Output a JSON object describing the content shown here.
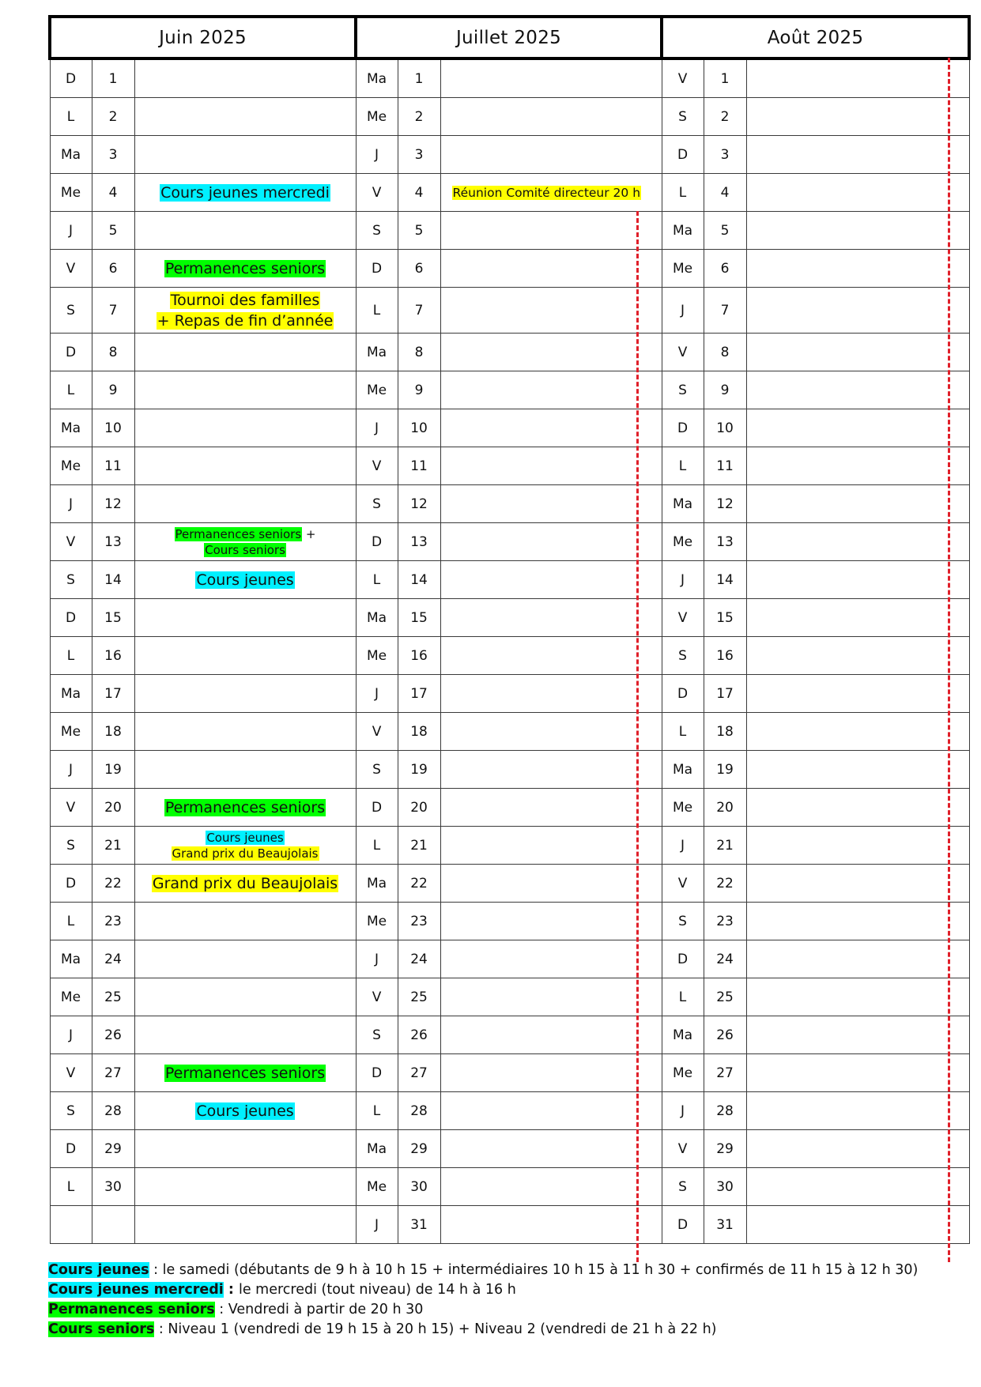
{
  "months": [
    {
      "label": "Juin 2025"
    },
    {
      "label": "Juillet 2025"
    },
    {
      "label": "Août 2025"
    }
  ],
  "highlight_colors": {
    "cyan": "#00f0ff",
    "green": "#00ff00",
    "yellow": "#ffff00",
    "dash_red": "#e0202a"
  },
  "rows": [
    {
      "juin": {
        "d": "D",
        "n": "1"
      },
      "juillet": {
        "d": "Ma",
        "n": "1"
      },
      "aout": {
        "d": "V",
        "n": "1"
      }
    },
    {
      "juin": {
        "d": "L",
        "n": "2"
      },
      "juillet": {
        "d": "Me",
        "n": "2"
      },
      "aout": {
        "d": "S",
        "n": "2"
      }
    },
    {
      "juin": {
        "d": "Ma",
        "n": "3"
      },
      "juillet": {
        "d": "J",
        "n": "3"
      },
      "aout": {
        "d": "D",
        "n": "3"
      }
    },
    {
      "juin": {
        "d": "Me",
        "n": "4",
        "events": [
          {
            "text": "Cours jeunes mercredi",
            "color": "cyan"
          }
        ]
      },
      "juillet": {
        "d": "V",
        "n": "4",
        "events": [
          {
            "text": "Réunion Comité directeur 20 h",
            "color": "yellow"
          }
        ]
      },
      "aout": {
        "d": "L",
        "n": "4"
      }
    },
    {
      "juin": {
        "d": "J",
        "n": "5"
      },
      "juillet": {
        "d": "S",
        "n": "5"
      },
      "aout": {
        "d": "Ma",
        "n": "5"
      }
    },
    {
      "juin": {
        "d": "V",
        "n": "6",
        "events": [
          {
            "text": "Permanences seniors",
            "color": "green"
          }
        ]
      },
      "juillet": {
        "d": "D",
        "n": "6"
      },
      "aout": {
        "d": "Me",
        "n": "6"
      }
    },
    {
      "juin": {
        "d": "S",
        "n": "7",
        "events": [
          {
            "text": "Tournoi des familles",
            "color": "yellow"
          },
          {
            "text": "+ Repas de fin d’année",
            "color": "yellow"
          }
        ]
      },
      "juillet": {
        "d": "L",
        "n": "7"
      },
      "aout": {
        "d": "J",
        "n": "7"
      }
    },
    {
      "juin": {
        "d": "D",
        "n": "8"
      },
      "juillet": {
        "d": "Ma",
        "n": "8"
      },
      "aout": {
        "d": "V",
        "n": "8"
      }
    },
    {
      "juin": {
        "d": "L",
        "n": "9"
      },
      "juillet": {
        "d": "Me",
        "n": "9"
      },
      "aout": {
        "d": "S",
        "n": "9"
      }
    },
    {
      "juin": {
        "d": "Ma",
        "n": "10"
      },
      "juillet": {
        "d": "J",
        "n": "10"
      },
      "aout": {
        "d": "D",
        "n": "10"
      }
    },
    {
      "juin": {
        "d": "Me",
        "n": "11"
      },
      "juillet": {
        "d": "V",
        "n": "11"
      },
      "aout": {
        "d": "L",
        "n": "11"
      }
    },
    {
      "juin": {
        "d": "J",
        "n": "12"
      },
      "juillet": {
        "d": "S",
        "n": "12"
      },
      "aout": {
        "d": "Ma",
        "n": "12"
      }
    },
    {
      "juin": {
        "d": "V",
        "n": "13",
        "small": true,
        "events": [
          {
            "text": "Permanences seniors",
            "color": "green",
            "suffix": " +"
          },
          {
            "text": "Cours seniors",
            "color": "green"
          }
        ]
      },
      "juillet": {
        "d": "D",
        "n": "13"
      },
      "aout": {
        "d": "Me",
        "n": "13"
      }
    },
    {
      "juin": {
        "d": "S",
        "n": "14",
        "events": [
          {
            "text": "Cours jeunes",
            "color": "cyan"
          }
        ]
      },
      "juillet": {
        "d": "L",
        "n": "14"
      },
      "aout": {
        "d": "J",
        "n": "14"
      }
    },
    {
      "juin": {
        "d": "D",
        "n": "15"
      },
      "juillet": {
        "d": "Ma",
        "n": "15"
      },
      "aout": {
        "d": "V",
        "n": "15"
      }
    },
    {
      "juin": {
        "d": "L",
        "n": "16"
      },
      "juillet": {
        "d": "Me",
        "n": "16"
      },
      "aout": {
        "d": "S",
        "n": "16"
      }
    },
    {
      "juin": {
        "d": "Ma",
        "n": "17"
      },
      "juillet": {
        "d": "J",
        "n": "17"
      },
      "aout": {
        "d": "D",
        "n": "17"
      }
    },
    {
      "juin": {
        "d": "Me",
        "n": "18"
      },
      "juillet": {
        "d": "V",
        "n": "18"
      },
      "aout": {
        "d": "L",
        "n": "18"
      }
    },
    {
      "juin": {
        "d": "J",
        "n": "19"
      },
      "juillet": {
        "d": "S",
        "n": "19"
      },
      "aout": {
        "d": "Ma",
        "n": "19"
      }
    },
    {
      "juin": {
        "d": "V",
        "n": "20",
        "events": [
          {
            "text": "Permanences seniors",
            "color": "green"
          }
        ]
      },
      "juillet": {
        "d": "D",
        "n": "20"
      },
      "aout": {
        "d": "Me",
        "n": "20"
      }
    },
    {
      "juin": {
        "d": "S",
        "n": "21",
        "small": true,
        "events": [
          {
            "text": "Cours jeunes",
            "color": "cyan"
          },
          {
            "text": "Grand prix du Beaujolais",
            "color": "yellow"
          }
        ]
      },
      "juillet": {
        "d": "L",
        "n": "21"
      },
      "aout": {
        "d": "J",
        "n": "21"
      }
    },
    {
      "juin": {
        "d": "D",
        "n": "22",
        "events": [
          {
            "text": "Grand prix du Beaujolais",
            "color": "yellow"
          }
        ]
      },
      "juillet": {
        "d": "Ma",
        "n": "22"
      },
      "aout": {
        "d": "V",
        "n": "22"
      }
    },
    {
      "juin": {
        "d": "L",
        "n": "23"
      },
      "juillet": {
        "d": "Me",
        "n": "23"
      },
      "aout": {
        "d": "S",
        "n": "23"
      }
    },
    {
      "juin": {
        "d": "Ma",
        "n": "24"
      },
      "juillet": {
        "d": "J",
        "n": "24"
      },
      "aout": {
        "d": "D",
        "n": "24"
      }
    },
    {
      "juin": {
        "d": "Me",
        "n": "25"
      },
      "juillet": {
        "d": "V",
        "n": "25"
      },
      "aout": {
        "d": "L",
        "n": "25"
      }
    },
    {
      "juin": {
        "d": "J",
        "n": "26"
      },
      "juillet": {
        "d": "S",
        "n": "26"
      },
      "aout": {
        "d": "Ma",
        "n": "26"
      }
    },
    {
      "juin": {
        "d": "V",
        "n": "27",
        "events": [
          {
            "text": "Permanences seniors",
            "color": "green"
          }
        ]
      },
      "juillet": {
        "d": "D",
        "n": "27"
      },
      "aout": {
        "d": "Me",
        "n": "27"
      }
    },
    {
      "juin": {
        "d": "S",
        "n": "28",
        "events": [
          {
            "text": "Cours jeunes",
            "color": "cyan"
          }
        ]
      },
      "juillet": {
        "d": "L",
        "n": "28"
      },
      "aout": {
        "d": "J",
        "n": "28"
      }
    },
    {
      "juin": {
        "d": "D",
        "n": "29"
      },
      "juillet": {
        "d": "Ma",
        "n": "29"
      },
      "aout": {
        "d": "V",
        "n": "29"
      }
    },
    {
      "juin": {
        "d": "L",
        "n": "30"
      },
      "juillet": {
        "d": "Me",
        "n": "30"
      },
      "aout": {
        "d": "S",
        "n": "30"
      }
    },
    {
      "juin": {
        "d": "",
        "n": ""
      },
      "juillet": {
        "d": "J",
        "n": "31"
      },
      "aout": {
        "d": "D",
        "n": "31"
      }
    }
  ],
  "legend": [
    {
      "key": "Cours jeunes",
      "color": "cyan",
      "sep": " : ",
      "text": "le samedi (débutants de 9 h à 10 h 15 + intermédiaires 10 h 15 à 11 h 30 + confirmés de 11 h 15 à 12 h 30)"
    },
    {
      "key": "Cours jeunes mercredi",
      "color": "cyan",
      "sep": " : ",
      "text": "le mercredi (tout niveau) de 14 h à 16 h"
    },
    {
      "key": "Permanences seniors",
      "color": "green",
      "sep": " : ",
      "text": "Vendredi à partir de 20 h 30"
    },
    {
      "key": "Cours seniors",
      "color": "green",
      "sep": " : ",
      "text": "Niveau 1 (vendredi de 19 h 15 à 20 h 15) + Niveau 2 (vendredi de 21 h à 22 h)"
    }
  ]
}
